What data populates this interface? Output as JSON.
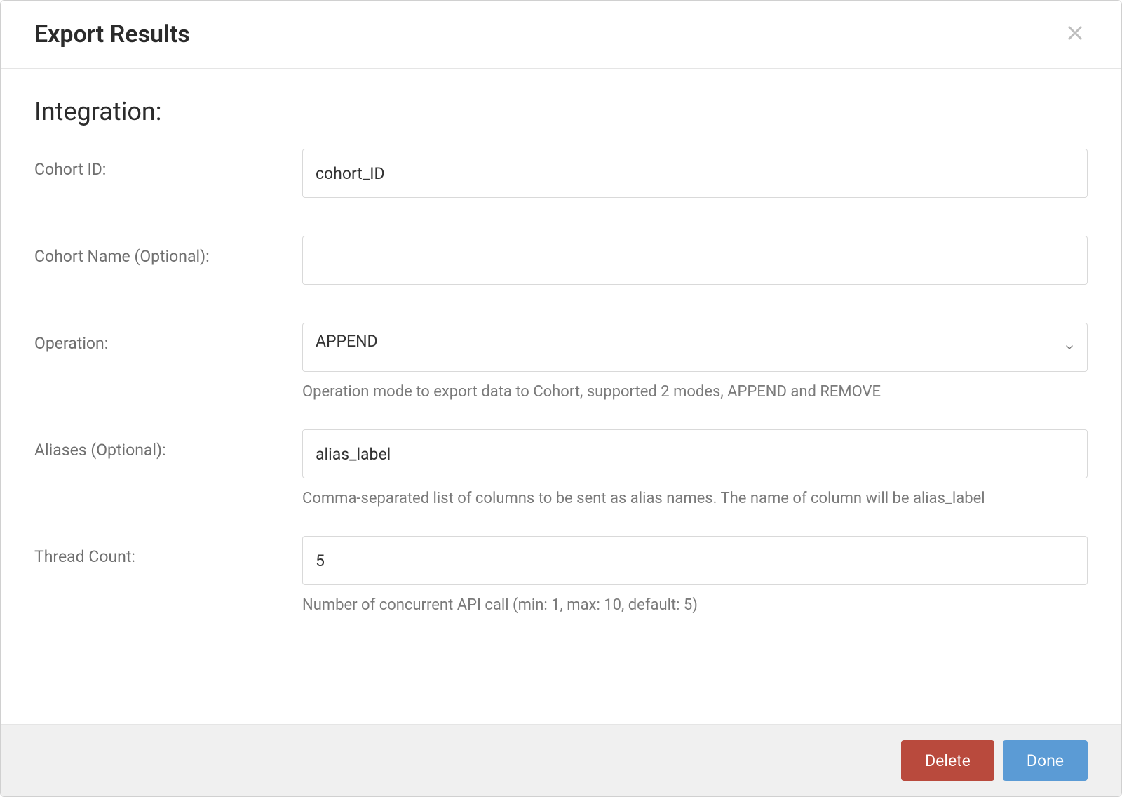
{
  "header": {
    "title": "Export Results"
  },
  "section": {
    "title": "Integration:"
  },
  "fields": {
    "cohort_id": {
      "label": "Cohort ID:",
      "value": "cohort_ID"
    },
    "cohort_name": {
      "label": "Cohort Name (Optional):",
      "value": ""
    },
    "operation": {
      "label": "Operation:",
      "value": "APPEND",
      "help": "Operation mode to export data to Cohort, supported 2 modes, APPEND and REMOVE"
    },
    "aliases": {
      "label": "Aliases (Optional):",
      "value": "alias_label",
      "help": "Comma-separated list of columns to be sent as alias names. The name of column will be alias_label"
    },
    "thread_count": {
      "label": "Thread Count:",
      "value": "5",
      "help": "Number of concurrent API call (min: 1, max: 10, default: 5)"
    }
  },
  "footer": {
    "delete_label": "Delete",
    "done_label": "Done"
  }
}
